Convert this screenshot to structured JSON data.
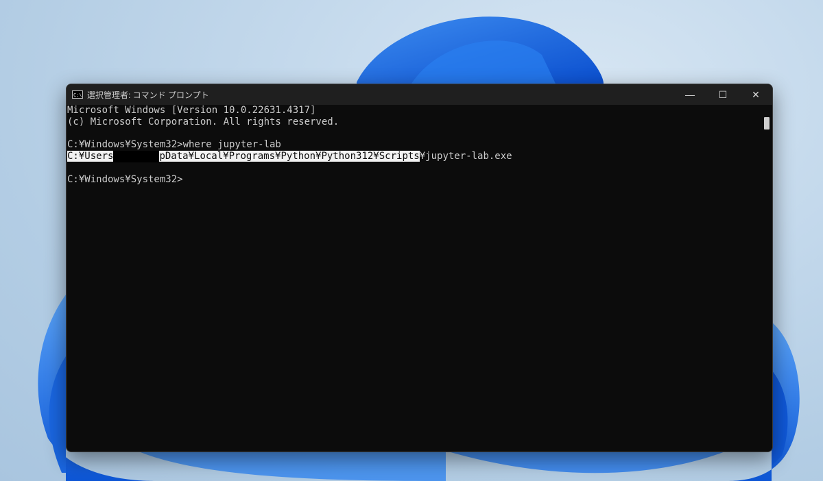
{
  "window": {
    "title": "選択管理者: コマンド プロンプト",
    "icon_label": "C:\\",
    "controls": {
      "minimize": "—",
      "maximize": "☐",
      "close": "✕"
    }
  },
  "console": {
    "lines": [
      "Microsoft Windows [Version 10.0.22631.4317]",
      "(c) Microsoft Corporation. All rights reserved.",
      "",
      "C:¥Windows¥System32>where jupyter-lab"
    ],
    "result": {
      "sel_start": "C:¥Users",
      "sel_end": "pData¥Local¥Programs¥Python¥Python312¥Scripts",
      "tail": "¥jupyter-lab.exe"
    },
    "prompt": "C:¥Windows¥System32>"
  },
  "colors": {
    "console_bg": "#0c0c0c",
    "console_text": "#cccccc",
    "selection_bg": "#f2f2f2",
    "titlebar_bg": "#1f1f1f",
    "wallpaper_blue": "#1f6fe0"
  }
}
